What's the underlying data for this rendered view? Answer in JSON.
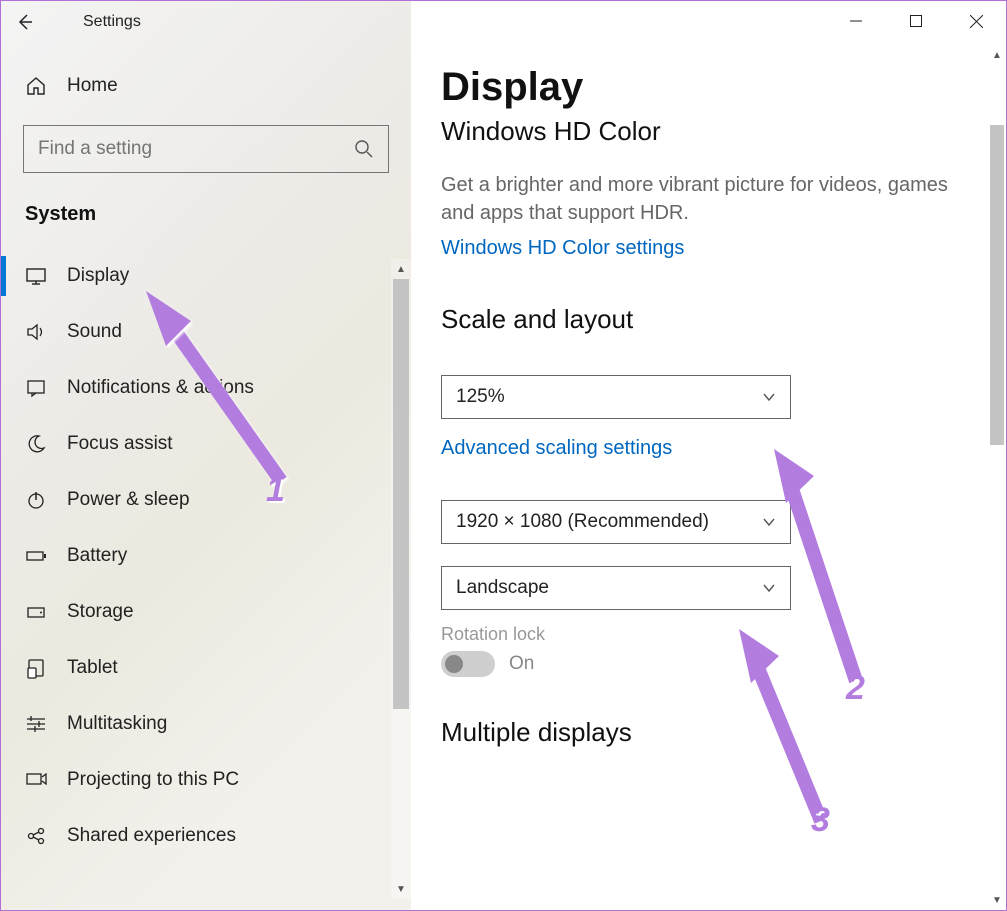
{
  "window": {
    "title": "Settings"
  },
  "sidebar": {
    "home_label": "Home",
    "search_placeholder": "Find a setting",
    "category": "System",
    "items": [
      {
        "label": "Display",
        "icon": "monitor",
        "active": true
      },
      {
        "label": "Sound",
        "icon": "sound",
        "active": false
      },
      {
        "label": "Notifications & actions",
        "icon": "notify",
        "active": false
      },
      {
        "label": "Focus assist",
        "icon": "moon",
        "active": false
      },
      {
        "label": "Power & sleep",
        "icon": "power",
        "active": false
      },
      {
        "label": "Battery",
        "icon": "battery",
        "active": false
      },
      {
        "label": "Storage",
        "icon": "storage",
        "active": false
      },
      {
        "label": "Tablet",
        "icon": "tablet",
        "active": false
      },
      {
        "label": "Multitasking",
        "icon": "multitask",
        "active": false
      },
      {
        "label": "Projecting to this PC",
        "icon": "project",
        "active": false
      },
      {
        "label": "Shared experiences",
        "icon": "shared",
        "active": false
      }
    ]
  },
  "main": {
    "heading": "Display",
    "hd_color_heading": "Windows HD Color",
    "hd_color_desc": "Get a brighter and more vibrant picture for videos, games and apps that support HDR.",
    "hd_color_link": "Windows HD Color settings",
    "scale_heading": "Scale and layout",
    "scale_value": "125%",
    "scaling_link": "Advanced scaling settings",
    "resolution_value": "1920 × 1080 (Recommended)",
    "orientation_value": "Landscape",
    "rotation_label": "Rotation lock",
    "rotation_value": "On",
    "multiple_heading": "Multiple displays"
  },
  "annotations": {
    "num1": "1",
    "num2": "2",
    "num3": "3"
  }
}
